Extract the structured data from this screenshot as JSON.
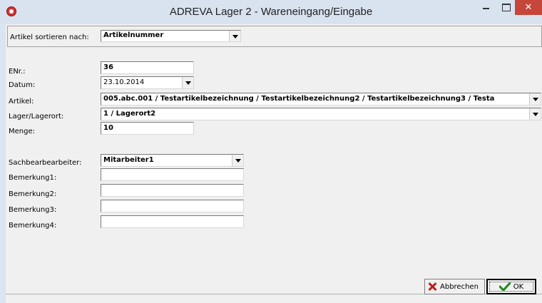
{
  "window": {
    "title": "ADREVA Lager 2 - Wareneingang/Eingabe",
    "close_glyph": "✕",
    "accent_color": "#c7463a"
  },
  "sort": {
    "label": "Artikel sortieren nach:",
    "value": "Artikelnummer"
  },
  "form": {
    "enr": {
      "label": "ENr.:",
      "value": "36"
    },
    "datum": {
      "label": "Datum:",
      "value": "23.10.2014"
    },
    "artikel": {
      "label": "Artikel:",
      "value": "005.abc.001 / Testartikelbezeichnung / Testartikelbezeichnung2 / Testartikelbezeichnung3 / Testa"
    },
    "lager": {
      "label": "Lager/Lagerort:",
      "value": "1 / Lagerort2"
    },
    "menge": {
      "label": "Menge:",
      "value": "10"
    },
    "sachbearbeiter": {
      "label": "Sachbearbearbeiter:",
      "value": "Mitarbeiter1"
    },
    "bemerkung1": {
      "label": "Bemerkung1:",
      "value": ""
    },
    "bemerkung2": {
      "label": "Bemerkung2:",
      "value": ""
    },
    "bemerkung3": {
      "label": "Bemerkung3:",
      "value": ""
    },
    "bemerkung4": {
      "label": "Bemerkung4:",
      "value": ""
    }
  },
  "buttons": {
    "cancel_label": "Abbrechen",
    "ok_label": "OK"
  }
}
